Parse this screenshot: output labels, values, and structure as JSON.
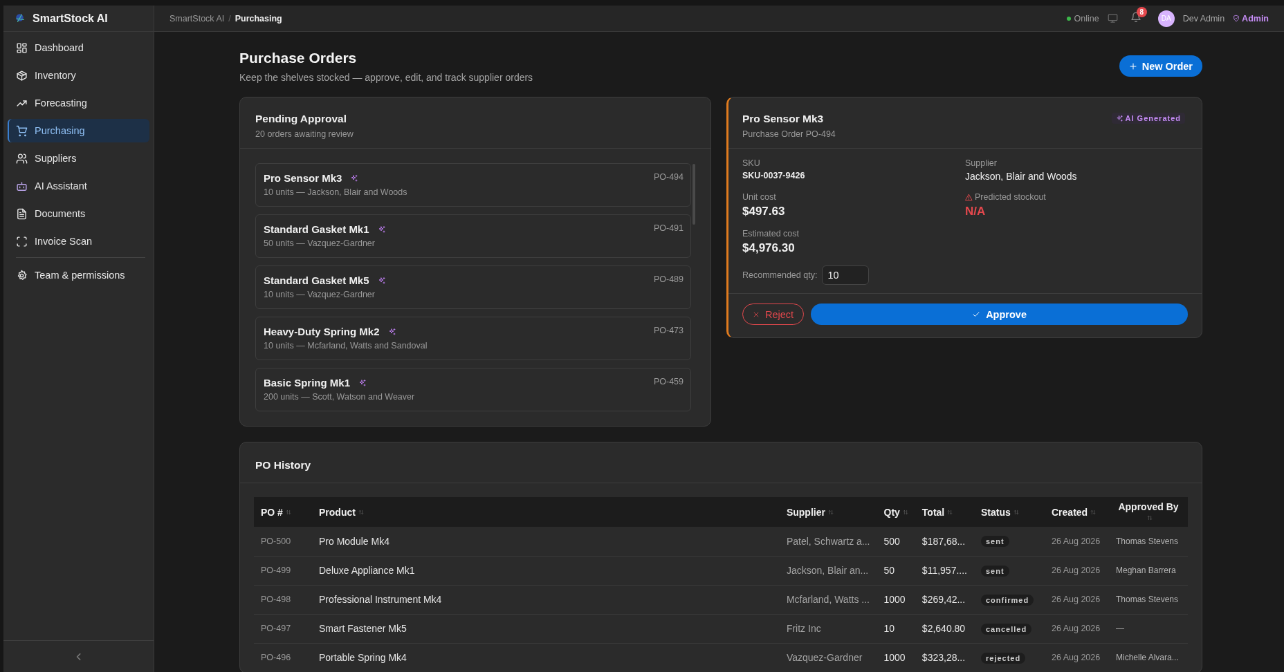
{
  "app": {
    "name": "SmartStock AI"
  },
  "sidebar": {
    "items": [
      {
        "label": "Dashboard",
        "kind": "grid",
        "selected": false
      },
      {
        "label": "Inventory",
        "kind": "box",
        "selected": false
      },
      {
        "label": "Forecasting",
        "kind": "trend",
        "selected": false
      },
      {
        "label": "Purchasing",
        "kind": "cart",
        "selected": true
      },
      {
        "label": "Suppliers",
        "kind": "users",
        "selected": false
      },
      {
        "label": "AI Assistant",
        "kind": "bot",
        "selected": false
      },
      {
        "label": "Documents",
        "kind": "doc",
        "selected": false
      },
      {
        "label": "Invoice Scan",
        "kind": "scan",
        "selected": false
      }
    ],
    "footer_items": [
      {
        "label": "Team & permissions",
        "kind": "gear",
        "selected": false
      }
    ]
  },
  "topbar": {
    "breadcrumb": [
      "SmartStock AI",
      "Purchasing"
    ],
    "breadcrumb_separator": "/",
    "status": "Online",
    "notifications": "8",
    "user": {
      "initials": "DA",
      "name": "Dev Admin",
      "role": "Admin"
    }
  },
  "page": {
    "title": "Purchase Orders",
    "subtitle": "Keep the shelves stocked — approve, edit, and track supplier orders",
    "new_button": "New Order"
  },
  "pending": {
    "title": "Pending Approval",
    "subtitle": "20 orders awaiting review",
    "orders": [
      {
        "product": "Pro Sensor Mk3",
        "details": "10 units — Jackson, Blair and Woods",
        "po": "PO-494"
      },
      {
        "product": "Standard Gasket Mk1",
        "details": "50 units — Vazquez-Gardner",
        "po": "PO-491"
      },
      {
        "product": "Standard Gasket Mk5",
        "details": "10 units — Vazquez-Gardner",
        "po": "PO-489"
      },
      {
        "product": "Heavy-Duty Spring Mk2",
        "details": "10 units — Mcfarland, Watts and Sandoval",
        "po": "PO-473"
      },
      {
        "product": "Basic Spring Mk1",
        "details": "200 units — Scott, Watson and Weaver",
        "po": "PO-459"
      }
    ]
  },
  "detail": {
    "title": "Pro Sensor Mk3",
    "subtitle": "Purchase Order PO-494",
    "badge": "AI Generated",
    "sku_label": "SKU",
    "sku": "SKU-0037-9426",
    "supplier_label": "Supplier",
    "supplier": "Jackson, Blair and Woods",
    "unit_cost_label": "Unit cost",
    "unit_cost": "$497.63",
    "stockout_label": "Predicted stockout",
    "stockout": "N/A",
    "estimated_label": "Estimated cost",
    "estimated": "$4,976.30",
    "qty_label": "Recommended qty:",
    "qty": "10",
    "reject": "Reject",
    "approve": "Approve"
  },
  "history": {
    "title": "PO History",
    "columns": [
      "PO #",
      "Product",
      "Supplier",
      "Qty",
      "Total",
      "Status",
      "Created",
      "Approved By"
    ],
    "rows": [
      {
        "po": "PO-500",
        "product": "Pro Module Mk4",
        "supplier": "Patel, Schwartz a...",
        "qty": "500",
        "total": "$187,68...",
        "status": "sent",
        "created": "26 Aug 2026",
        "approved_by": "Thomas Stevens"
      },
      {
        "po": "PO-499",
        "product": "Deluxe Appliance Mk1",
        "supplier": "Jackson, Blair an...",
        "qty": "50",
        "total": "$11,957....",
        "status": "sent",
        "created": "26 Aug 2026",
        "approved_by": "Meghan Barrera"
      },
      {
        "po": "PO-498",
        "product": "Professional Instrument Mk4",
        "supplier": "Mcfarland, Watts ...",
        "qty": "1000",
        "total": "$269,42...",
        "status": "confirmed",
        "created": "26 Aug 2026",
        "approved_by": "Thomas Stevens"
      },
      {
        "po": "PO-497",
        "product": "Smart Fastener Mk5",
        "supplier": "Fritz Inc",
        "qty": "10",
        "total": "$2,640.80",
        "status": "cancelled",
        "created": "26 Aug 2026",
        "approved_by": "—"
      },
      {
        "po": "PO-496",
        "product": "Portable Spring Mk4",
        "supplier": "Vazquez-Gardner",
        "qty": "1000",
        "total": "$323,28...",
        "status": "rejected",
        "created": "26 Aug 2026",
        "approved_by": "Michelle Alvara..."
      }
    ]
  }
}
